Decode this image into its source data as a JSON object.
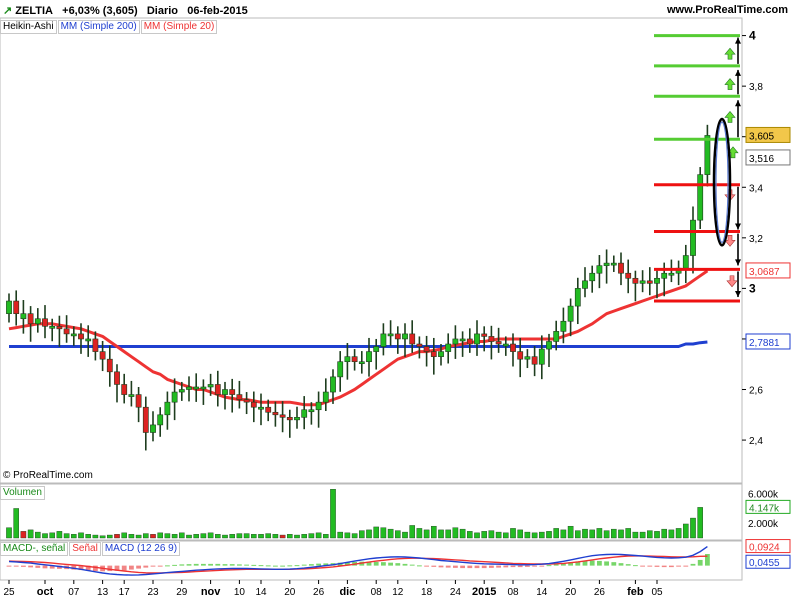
{
  "header": {
    "symbol": "ZELTIA",
    "change": "+6,03% (3,605)",
    "period": "Diario",
    "date": "06-feb-2015",
    "site": "www.ProRealTime.com"
  },
  "legend": {
    "heikin": "Heikin-Ashi",
    "ma200": "MM (Simple 200)",
    "ma20": "MM (Simple 20)"
  },
  "copyright": "© ProRealTime.com",
  "volume_legend": "Volumen",
  "macd_legend": {
    "macd_signal": "MACD-, señal",
    "signal": "Señal",
    "macd": "MACD (12 26 9)"
  },
  "colors": {
    "up": "#22bb22",
    "down": "#dd2222",
    "ma200": "#1f3fd0",
    "ma20": "#ee3333",
    "level_green": "#55cc33",
    "level_red": "#ee1111"
  },
  "chart_data": [
    {
      "type": "candlestick",
      "title": "ZELTIA",
      "ylim": [
        2.25,
        4.03
      ],
      "y_ticks": [
        "4",
        "3,8",
        "3,6",
        "3,4",
        "3,2",
        "3",
        "2,8",
        "2,6",
        "2,4"
      ],
      "x_labels": [
        "25",
        "oct",
        "07",
        "13",
        "17",
        "23",
        "29",
        "nov",
        "10",
        "14",
        "20",
        "26",
        "dic",
        "08",
        "12",
        "18",
        "24",
        "2015",
        "08",
        "14",
        "20",
        "26",
        "feb",
        "05"
      ],
      "price_labels": [
        "3,605",
        "3,516",
        "3,0687",
        "2,7881"
      ],
      "series": [
        {
          "name": "Heikin-Ashi",
          "open": [
            2.9,
            2.95,
            2.88,
            2.9,
            2.86,
            2.88,
            2.85,
            2.85,
            2.84,
            2.82,
            2.82,
            2.8,
            2.8,
            2.75,
            2.72,
            2.67,
            2.62,
            2.58,
            2.58,
            2.53,
            2.43,
            2.46,
            2.5,
            2.55,
            2.59,
            2.6,
            2.61,
            2.61,
            2.61,
            2.62,
            2.58,
            2.6,
            2.58,
            2.56,
            2.55,
            2.53,
            2.53,
            2.51,
            2.5,
            2.49,
            2.48,
            2.49,
            2.52,
            2.52,
            2.55,
            2.59,
            2.65,
            2.71,
            2.73,
            2.71,
            2.71,
            2.75,
            2.77,
            2.82,
            2.82,
            2.8,
            2.82,
            2.78,
            2.77,
            2.75,
            2.73,
            2.75,
            2.78,
            2.8,
            2.8,
            2.78,
            2.82,
            2.81,
            2.79,
            2.78,
            2.78,
            2.75,
            2.72,
            2.73,
            2.7,
            2.76,
            2.79,
            2.83,
            2.87,
            2.93,
            3.0,
            3.03,
            3.06,
            3.09,
            3.1,
            3.1,
            3.06,
            3.04,
            3.02,
            3.03,
            3.02,
            3.04,
            3.06,
            3.06,
            3.08,
            3.13,
            3.27,
            3.45
          ],
          "close": [
            2.95,
            2.9,
            2.9,
            2.86,
            2.88,
            2.85,
            2.85,
            2.84,
            2.82,
            2.82,
            2.8,
            2.8,
            2.75,
            2.72,
            2.67,
            2.62,
            2.58,
            2.58,
            2.53,
            2.43,
            2.46,
            2.5,
            2.55,
            2.59,
            2.6,
            2.61,
            2.61,
            2.61,
            2.62,
            2.58,
            2.6,
            2.58,
            2.56,
            2.55,
            2.53,
            2.53,
            2.51,
            2.5,
            2.49,
            2.48,
            2.49,
            2.52,
            2.52,
            2.55,
            2.59,
            2.65,
            2.71,
            2.73,
            2.71,
            2.71,
            2.75,
            2.77,
            2.82,
            2.82,
            2.8,
            2.82,
            2.78,
            2.77,
            2.75,
            2.73,
            2.75,
            2.78,
            2.8,
            2.8,
            2.78,
            2.82,
            2.81,
            2.79,
            2.78,
            2.78,
            2.75,
            2.72,
            2.73,
            2.7,
            2.76,
            2.79,
            2.83,
            2.87,
            2.93,
            3.0,
            3.03,
            3.06,
            3.09,
            3.1,
            3.1,
            3.06,
            3.04,
            3.02,
            3.03,
            3.02,
            3.04,
            3.06,
            3.06,
            3.08,
            3.13,
            3.27,
            3.45,
            3.605
          ]
        },
        {
          "name": "MM (Simple 200)",
          "values": [
            2.77,
            2.77,
            2.77,
            2.77,
            2.77,
            2.77,
            2.77,
            2.77,
            2.77,
            2.77,
            2.77,
            2.77,
            2.77,
            2.77,
            2.77,
            2.77,
            2.77,
            2.77,
            2.77,
            2.77,
            2.77,
            2.77,
            2.77,
            2.77,
            2.77,
            2.77,
            2.77,
            2.77,
            2.77,
            2.77,
            2.77,
            2.77,
            2.77,
            2.77,
            2.77,
            2.77,
            2.77,
            2.77,
            2.77,
            2.77,
            2.77,
            2.77,
            2.77,
            2.77,
            2.77,
            2.77,
            2.77,
            2.77,
            2.77,
            2.77,
            2.77,
            2.77,
            2.77,
            2.77,
            2.77,
            2.77,
            2.77,
            2.77,
            2.77,
            2.77,
            2.77,
            2.77,
            2.77,
            2.77,
            2.77,
            2.77,
            2.77,
            2.77,
            2.77,
            2.77,
            2.77,
            2.77,
            2.77,
            2.77,
            2.77,
            2.77,
            2.77,
            2.77,
            2.77,
            2.77,
            2.77,
            2.77,
            2.77,
            2.77,
            2.77,
            2.77,
            2.77,
            2.77,
            2.77,
            2.77,
            2.77,
            2.77,
            2.77,
            2.77,
            2.78,
            2.78,
            2.785,
            2.788
          ]
        },
        {
          "name": "MM (Simple 20)",
          "values": [
            2.84,
            2.845,
            2.85,
            2.855,
            2.86,
            2.86,
            2.86,
            2.855,
            2.85,
            2.845,
            2.84,
            2.83,
            2.82,
            2.81,
            2.79,
            2.77,
            2.75,
            2.73,
            2.71,
            2.69,
            2.67,
            2.66,
            2.64,
            2.63,
            2.62,
            2.61,
            2.6,
            2.6,
            2.59,
            2.58,
            2.57,
            2.565,
            2.56,
            2.56,
            2.555,
            2.55,
            2.55,
            2.55,
            2.55,
            2.55,
            2.545,
            2.54,
            2.54,
            2.54,
            2.55,
            2.56,
            2.57,
            2.585,
            2.6,
            2.62,
            2.64,
            2.66,
            2.68,
            2.7,
            2.72,
            2.73,
            2.74,
            2.75,
            2.75,
            2.755,
            2.76,
            2.77,
            2.775,
            2.78,
            2.785,
            2.79,
            2.79,
            2.795,
            2.8,
            2.8,
            2.8,
            2.8,
            2.8,
            2.8,
            2.8,
            2.8,
            2.8,
            2.81,
            2.82,
            2.83,
            2.845,
            2.86,
            2.88,
            2.9,
            2.91,
            2.92,
            2.93,
            2.94,
            2.95,
            2.96,
            2.97,
            2.98,
            2.99,
            3.0,
            3.01,
            3.03,
            3.05,
            3.069
          ]
        }
      ],
      "levels": [
        {
          "value": 4.0,
          "color": "green"
        },
        {
          "value": 3.88,
          "color": "green"
        },
        {
          "value": 3.76,
          "color": "green"
        },
        {
          "value": 3.59,
          "color": "green"
        },
        {
          "value": 3.41,
          "color": "red"
        },
        {
          "value": 3.225,
          "color": "red"
        },
        {
          "value": 3.075,
          "color": "red"
        },
        {
          "value": 2.95,
          "color": "red"
        }
      ]
    },
    {
      "type": "bar",
      "title": "Volumen",
      "y_ticks": [
        "6.000k",
        "4.147k",
        "2.000k"
      ],
      "ylim": [
        0,
        6500
      ],
      "values": [
        1400,
        4000,
        900,
        1100,
        800,
        600,
        700,
        900,
        600,
        500,
        700,
        500,
        400,
        300,
        400,
        500,
        700,
        500,
        400,
        600,
        500,
        700,
        600,
        500,
        700,
        400,
        500,
        600,
        700,
        500,
        400,
        500,
        600,
        600,
        500,
        500,
        600,
        500,
        400,
        500,
        400,
        500,
        600,
        700,
        500,
        6600,
        800,
        700,
        600,
        1000,
        1100,
        1500,
        1400,
        1200,
        1000,
        800,
        1700,
        1300,
        1100,
        1600,
        1100,
        1100,
        1400,
        1200,
        900,
        700,
        900,
        1000,
        800,
        700,
        1300,
        1100,
        800,
        700,
        800,
        900,
        1300,
        1100,
        1600,
        1000,
        1200,
        1100,
        1300,
        1000,
        1200,
        1100,
        1300,
        800,
        800,
        1000,
        900,
        1200,
        1100,
        1300,
        1900,
        2700,
        4147
      ],
      "down": [
        2,
        15,
        20,
        38
      ]
    },
    {
      "type": "area",
      "title": "MACD (12 26 9)",
      "y_ticks": [
        "0,0924",
        "0,0455"
      ],
      "macd": [
        0.02,
        0.018,
        0.015,
        0.012,
        0.008,
        0.004,
        0.0,
        -0.004,
        -0.008,
        -0.013,
        -0.018,
        -0.024,
        -0.03,
        -0.036,
        -0.04,
        -0.043,
        -0.045,
        -0.046,
        -0.045,
        -0.043,
        -0.04,
        -0.037,
        -0.034,
        -0.031,
        -0.028,
        -0.025,
        -0.022,
        -0.02,
        -0.018,
        -0.016,
        -0.015,
        -0.014,
        -0.014,
        -0.014,
        -0.015,
        -0.016,
        -0.017,
        -0.018,
        -0.018,
        -0.017,
        -0.015,
        -0.012,
        -0.008,
        -0.004,
        0.0,
        0.004,
        0.01,
        0.016,
        0.022,
        0.028,
        0.033,
        0.037,
        0.04,
        0.042,
        0.043,
        0.042,
        0.04,
        0.037,
        0.033,
        0.029,
        0.025,
        0.022,
        0.019,
        0.016,
        0.013,
        0.011,
        0.009,
        0.008,
        0.007,
        0.006,
        0.005,
        0.004,
        0.004,
        0.005,
        0.007,
        0.01,
        0.015,
        0.021,
        0.028,
        0.035,
        0.042,
        0.048,
        0.052,
        0.054,
        0.055,
        0.054,
        0.052,
        0.049,
        0.046,
        0.043,
        0.04,
        0.038,
        0.037,
        0.038,
        0.041,
        0.05,
        0.068,
        0.0924
      ],
      "signal": [
        0.022,
        0.021,
        0.02,
        0.019,
        0.017,
        0.015,
        0.012,
        0.009,
        0.006,
        0.003,
        0.0,
        -0.004,
        -0.008,
        -0.013,
        -0.018,
        -0.022,
        -0.026,
        -0.03,
        -0.033,
        -0.035,
        -0.036,
        -0.036,
        -0.035,
        -0.034,
        -0.033,
        -0.031,
        -0.029,
        -0.027,
        -0.025,
        -0.023,
        -0.021,
        -0.02,
        -0.019,
        -0.018,
        -0.018,
        -0.018,
        -0.018,
        -0.018,
        -0.018,
        -0.018,
        -0.017,
        -0.016,
        -0.014,
        -0.012,
        -0.009,
        -0.006,
        -0.002,
        0.002,
        0.007,
        0.012,
        0.017,
        0.022,
        0.026,
        0.03,
        0.033,
        0.035,
        0.036,
        0.036,
        0.035,
        0.034,
        0.032,
        0.03,
        0.028,
        0.026,
        0.023,
        0.021,
        0.019,
        0.017,
        0.015,
        0.013,
        0.011,
        0.01,
        0.009,
        0.008,
        0.008,
        0.008,
        0.009,
        0.011,
        0.014,
        0.018,
        0.023,
        0.028,
        0.033,
        0.037,
        0.041,
        0.044,
        0.046,
        0.047,
        0.047,
        0.046,
        0.045,
        0.044,
        0.043,
        0.042,
        0.042,
        0.043,
        0.045,
        0.0455
      ]
    }
  ]
}
